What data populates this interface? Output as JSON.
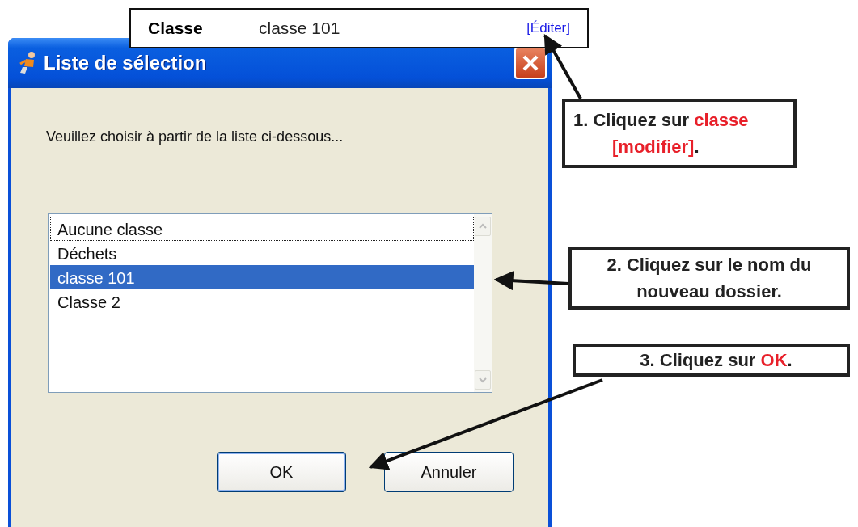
{
  "field_strip": {
    "label": "Classe",
    "value": "classe 101",
    "link": "[Éditer]"
  },
  "window": {
    "title": "Liste de sélection",
    "message": "Veuillez choisir à partir de la liste ci-dessous...",
    "list": [
      {
        "label": "Aucune classe",
        "selected": false,
        "focused": true
      },
      {
        "label": "Déchets",
        "selected": false,
        "focused": false
      },
      {
        "label": "classe 101",
        "selected": true,
        "focused": false
      },
      {
        "label": "Classe 2",
        "selected": false,
        "focused": false
      }
    ],
    "buttons": [
      {
        "label": "OK",
        "default": true
      },
      {
        "label": "Annuler",
        "default": false
      }
    ]
  },
  "callouts": [
    {
      "lines": [
        [
          {
            "text": "1. Cliquez sur ",
            "highlight": false
          },
          {
            "text": "classe",
            "highlight": true
          }
        ],
        [
          {
            "text": "[modifier]",
            "highlight": true
          },
          {
            "text": ".",
            "highlight": false
          }
        ]
      ]
    },
    {
      "lines": [
        [
          {
            "text": "2. Cliquez sur le nom du",
            "highlight": false
          }
        ],
        [
          {
            "text": "nouveau dossier.",
            "highlight": false
          }
        ]
      ]
    },
    {
      "lines": [
        [
          {
            "text": "3. Cliquez sur ",
            "highlight": false
          },
          {
            "text": "OK",
            "highlight": true
          },
          {
            "text": ".",
            "highlight": false
          }
        ]
      ]
    }
  ]
}
